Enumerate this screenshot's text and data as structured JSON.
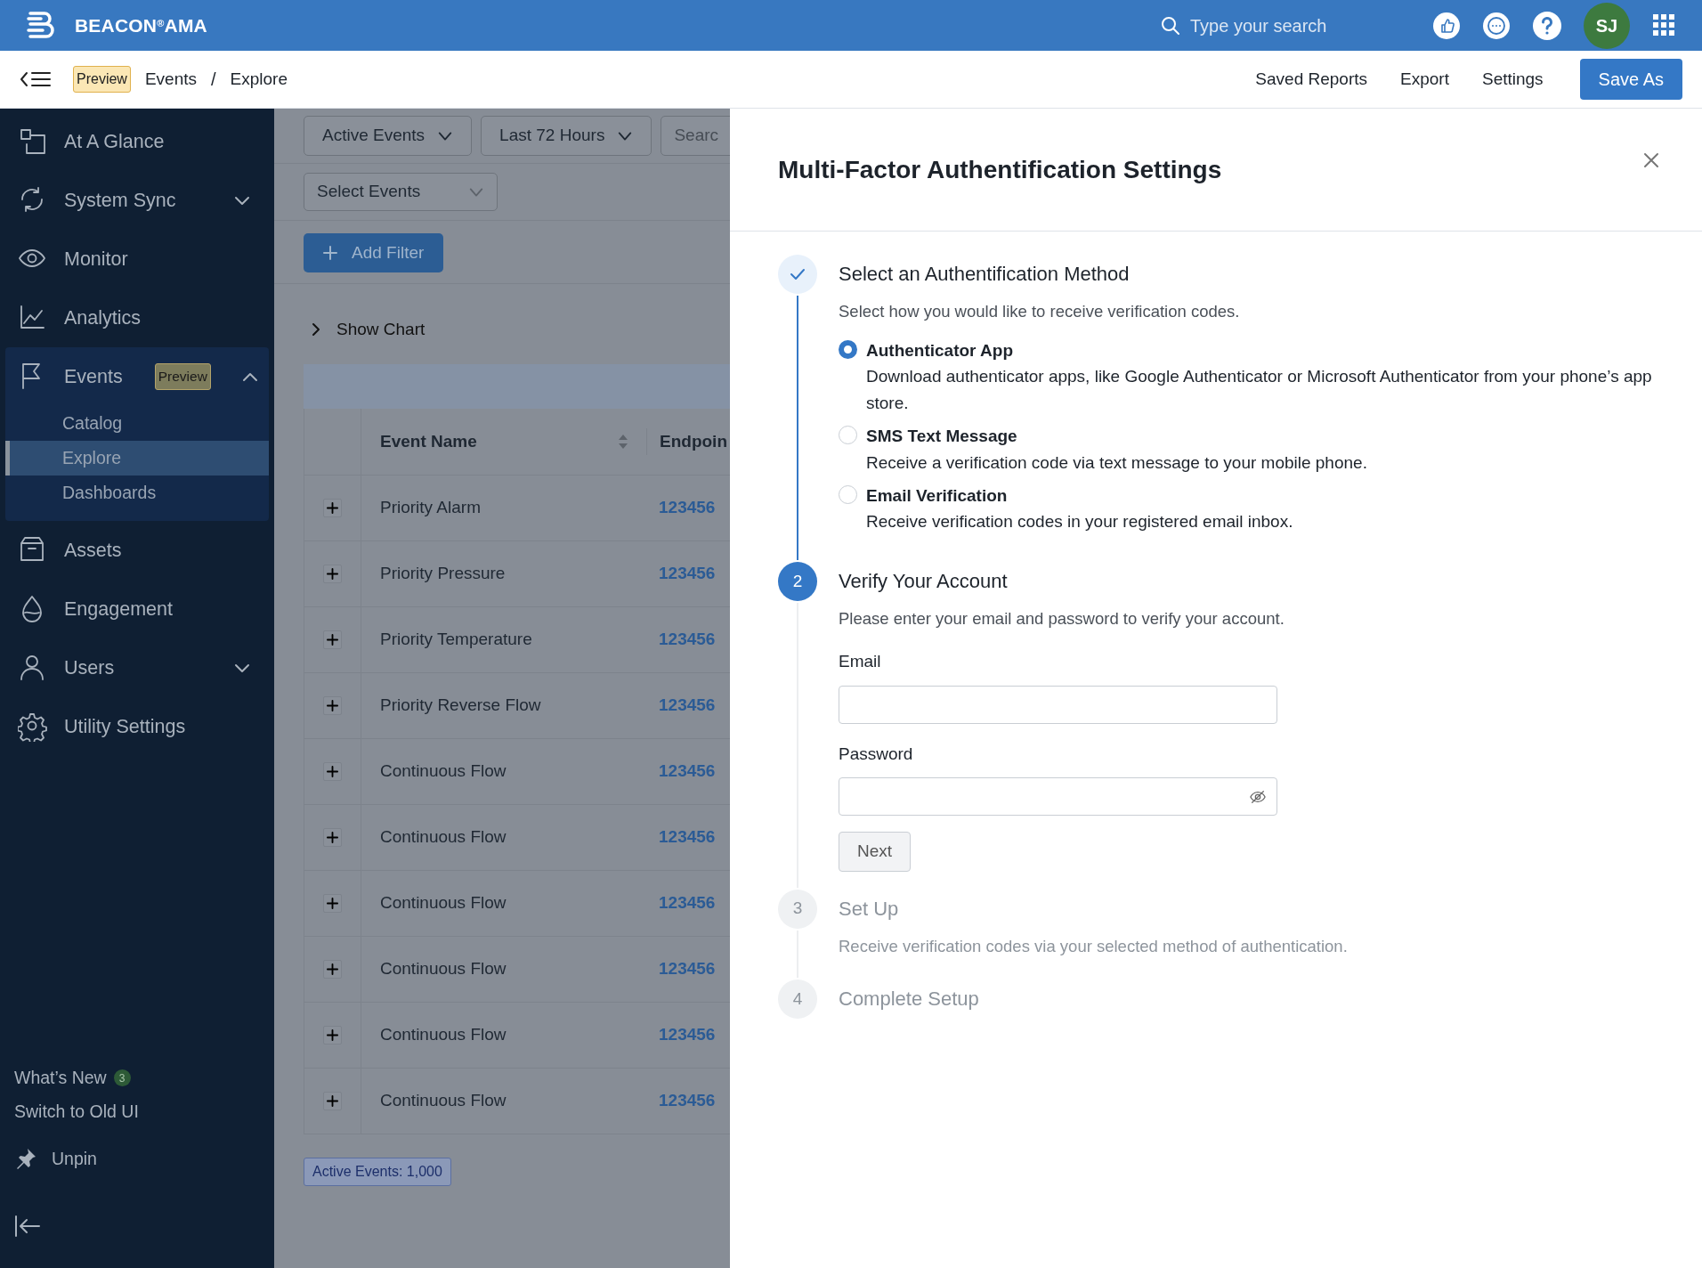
{
  "app": {
    "brand": "BEACON$^{®}$AMA"
  },
  "search": {
    "placeholder": "Type your search"
  },
  "user": {
    "initials": "SJ"
  },
  "breadcrumb": {
    "badge": "Preview",
    "items": [
      "Events",
      "Explore"
    ],
    "separator": "/"
  },
  "toolbar": {
    "links": [
      "Saved Reports",
      "Export",
      "Settings"
    ],
    "primary": "Save As"
  },
  "sidebar": {
    "items": [
      {
        "label": "At A Glance",
        "selected": false
      },
      {
        "label": "System Sync",
        "selected": false,
        "expanded": false
      },
      {
        "label": "Monitor",
        "selected": false
      },
      {
        "label": "Analytics",
        "selected": false
      },
      {
        "label": "Events",
        "selected": false,
        "expanded": true,
        "badge": "Preview",
        "children": [
          {
            "label": "Catalog",
            "selected": false
          },
          {
            "label": "Explore",
            "selected": true
          },
          {
            "label": "Dashboards",
            "selected": false
          }
        ]
      },
      {
        "label": "Assets",
        "selected": false
      },
      {
        "label": "Engagement",
        "selected": false
      },
      {
        "label": "Users",
        "selected": false,
        "expanded": false
      },
      {
        "label": "Utility Settings",
        "selected": false
      }
    ],
    "whats_new": {
      "label": "What’s New",
      "count": "3"
    },
    "switch_ui": "Switch to Old UI",
    "unpin": "Unpin"
  },
  "filters": {
    "dropdowns": [
      "Active Events",
      "Last 72 Hours"
    ],
    "search_placeholder": "Searc",
    "event_select": "Select Events",
    "add_filter": "Add Filter"
  },
  "show_chart": {
    "label": "Show Chart",
    "expanded": false
  },
  "table": {
    "columns": [
      "Event Name",
      "Endpoin"
    ],
    "rows": [
      {
        "event_name": "Priority Alarm",
        "endpoint": "123456"
      },
      {
        "event_name": "Priority Pressure",
        "endpoint": "123456"
      },
      {
        "event_name": "Priority Temperature",
        "endpoint": "123456"
      },
      {
        "event_name": "Priority Reverse Flow",
        "endpoint": "123456"
      },
      {
        "event_name": "Continuous Flow",
        "endpoint": "123456"
      },
      {
        "event_name": "Continuous Flow",
        "endpoint": "123456"
      },
      {
        "event_name": "Continuous Flow",
        "endpoint": "123456"
      },
      {
        "event_name": "Continuous Flow",
        "endpoint": "123456"
      },
      {
        "event_name": "Continuous Flow",
        "endpoint": "123456"
      },
      {
        "event_name": "Continuous Flow",
        "endpoint": "123456"
      }
    ]
  },
  "count_badge": "Active Events: 1,000",
  "panel": {
    "title": "Multi-Factor Authentification Settings",
    "steps": [
      {
        "complete": true,
        "current": false,
        "title": "Select an Authentification Method",
        "description": "Select how you would like to receive verification codes.",
        "options": [
          {
            "label": "Authenticator App",
            "description": "Download authenticator apps, like Google Authenticator or Microsoft Authenticator from your phone’s app store.",
            "selected": true
          },
          {
            "label": "SMS Text Message",
            "description": "Receive a verification code via text message to your mobile phone.",
            "selected": false
          },
          {
            "label": "Email Verification",
            "description": "Receive verification codes in your registered email inbox.",
            "selected": false
          }
        ]
      },
      {
        "complete": false,
        "current": true,
        "number": "2",
        "title": "Verify Your Account",
        "description": "Please enter your email and password to verify your account.",
        "fields": [
          {
            "kind": "text",
            "label": "Email"
          },
          {
            "kind": "password",
            "label": "Password"
          }
        ],
        "button": "Next"
      },
      {
        "complete": false,
        "current": false,
        "number": "3",
        "title": "Set Up",
        "description": "Receive verification codes via your selected method of authentication."
      },
      {
        "complete": false,
        "current": false,
        "number": "4",
        "title": "Complete Setup"
      }
    ]
  }
}
